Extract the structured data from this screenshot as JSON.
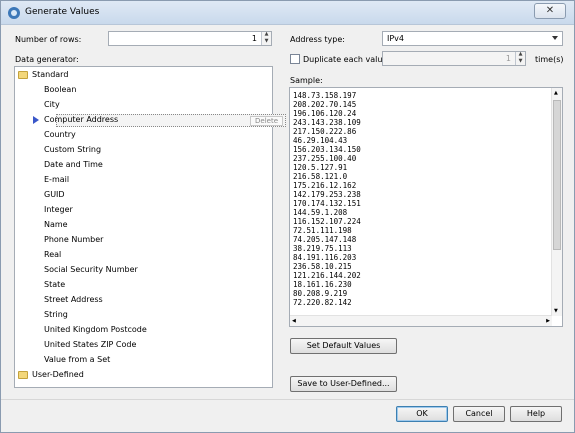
{
  "window": {
    "title": "Generate Values",
    "close_glyph": "✕"
  },
  "rows": {
    "label": "Number of rows:",
    "value": "1"
  },
  "generator": {
    "label": "Data generator:",
    "standard_folder": "Standard",
    "items": [
      "Boolean",
      "City",
      "Computer Address",
      "Country",
      "Custom String",
      "Date and Time",
      "E-mail",
      "GUID",
      "Integer",
      "Name",
      "Phone Number",
      "Real",
      "Social Security Number",
      "State",
      "Street Address",
      "String",
      "United Kingdom Postcode",
      "United States ZIP Code",
      "Value from a Set"
    ],
    "selected_index": 2,
    "delete_label": "Delete",
    "user_folder": "User-Defined"
  },
  "address": {
    "label": "Address type:",
    "value": "IPv4"
  },
  "duplicate": {
    "label": "Duplicate each value",
    "value": "1",
    "suffix": "time(s)",
    "checked": false
  },
  "sample": {
    "label": "Sample:",
    "values": [
      "148.73.158.197",
      "208.202.70.145",
      "196.106.120.24",
      "243.143.238.109",
      "217.150.222.86",
      "46.29.104.43",
      "156.203.134.150",
      "237.255.100.40",
      "120.5.127.91",
      "216.58.121.0",
      "175.216.12.162",
      "142.179.253.238",
      "170.174.132.151",
      "144.59.1.208",
      "116.152.107.224",
      "72.51.111.198",
      "74.205.147.148",
      "38.219.75.113",
      "84.191.116.203",
      "236.58.10.215",
      "121.216.144.202",
      "18.161.16.230",
      "80.208.9.219",
      "72.220.82.142"
    ]
  },
  "buttons": {
    "set_default": "Set Default Values",
    "save_user": "Save to User-Defined...",
    "ok": "OK",
    "cancel": "Cancel",
    "help": "Help"
  }
}
